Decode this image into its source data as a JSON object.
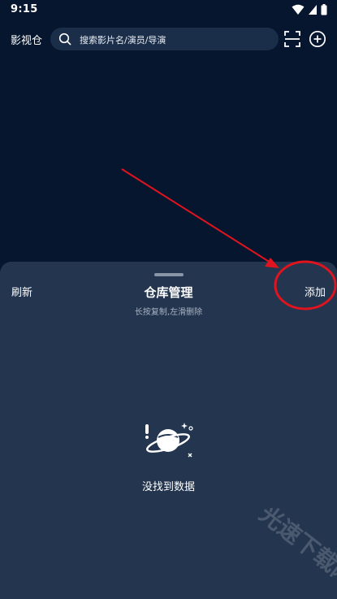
{
  "status_bar": {
    "time": "9:15",
    "icons": [
      "wifi-icon",
      "signal-icon",
      "battery-icon"
    ]
  },
  "header": {
    "app_title": "影视仓",
    "search": {
      "placeholder": "搜索影片名/演员/导演"
    },
    "icons": [
      "search-icon",
      "scan-icon",
      "add-circle-icon"
    ]
  },
  "sheet": {
    "refresh_label": "刷新",
    "title": "仓库管理",
    "subtitle": "长按复制,左滑删除",
    "add_label": "添加"
  },
  "empty_state": {
    "icon": "planet-icon",
    "text": "没找到数据"
  },
  "watermark": {
    "text": "光速下载网"
  },
  "colors": {
    "background": "#06162e",
    "search_bg": "#1b2e49",
    "sheet_bg": "#24354f",
    "annotation": "#e0141e"
  }
}
